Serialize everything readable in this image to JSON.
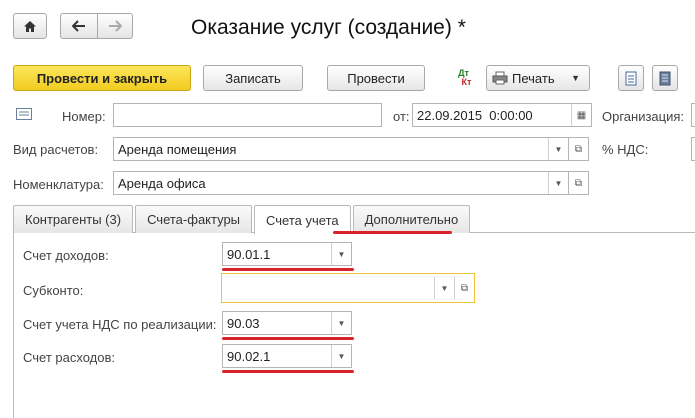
{
  "window": {
    "title": "Оказание услуг (создание) *"
  },
  "nav": {
    "home_icon": "home-icon",
    "back_icon": "arrow-left-icon",
    "forward_icon": "arrow-right-icon"
  },
  "toolbar": {
    "post_close_label": "Провести и закрыть",
    "save_label": "Записать",
    "post_label": "Провести",
    "dtkt_label_top": "Дт",
    "dtkt_label_bottom": "Кт",
    "print_label": "Печать"
  },
  "header": {
    "number_label": "Номер:",
    "number_value": "",
    "date_label": "от:",
    "date_value": "22.09.2015  0:00:00",
    "org_label": "Организация:",
    "calc_type_label": "Вид расчетов:",
    "calc_type_value": "Аренда помещения",
    "vat_label": "% НДС:",
    "nomenclature_label": "Номенклатура:",
    "nomenclature_value": "Аренда офиса"
  },
  "tabs": [
    {
      "label": "Контрагенты (3)"
    },
    {
      "label": "Счета-фактуры"
    },
    {
      "label": "Счета учета"
    },
    {
      "label": "Дополнительно"
    }
  ],
  "accounts": {
    "income_label": "Счет доходов:",
    "income_value": "90.01.1",
    "subconto_label": "Субконто:",
    "subconto_value": "",
    "vat_sales_label": "Счет учета НДС по реализации:",
    "vat_sales_value": "90.03",
    "expense_label": "Счет расходов:",
    "expense_value": "90.02.1"
  },
  "colors": {
    "accent": "#f5d32d",
    "highlight_red": "#d8232a",
    "focus_border": "#f0c23a"
  }
}
